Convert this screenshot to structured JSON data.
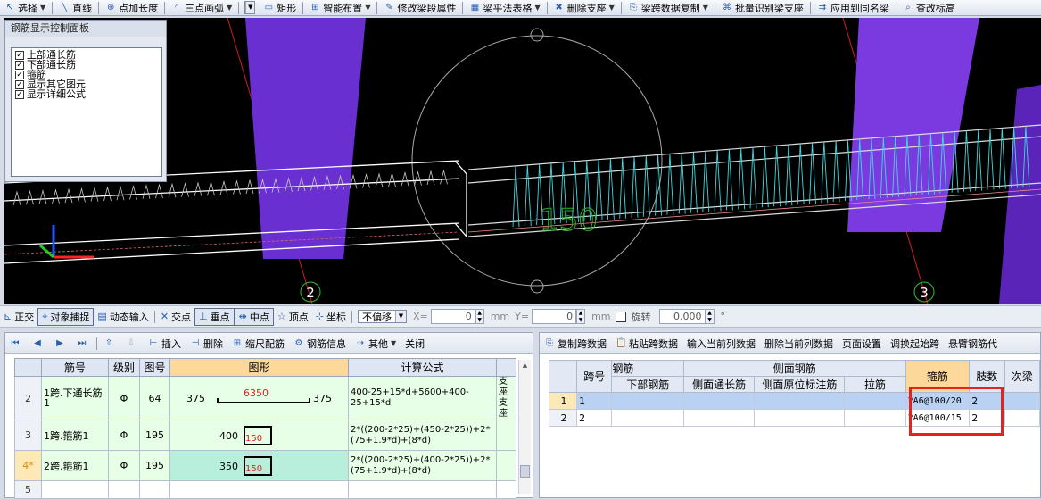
{
  "toolbar": {
    "items": [
      {
        "label": "选择",
        "icon": "cursor-icon",
        "dropdown": true
      },
      {
        "label": "直线",
        "icon": "line-icon",
        "dropdown": false
      },
      {
        "label": "点加长度",
        "icon": "point-length-icon",
        "dropdown": false
      },
      {
        "label": "三点画弧",
        "icon": "arc-icon",
        "dropdown": true
      },
      {
        "label": "矩形",
        "icon": "rectangle-icon",
        "dropdown": false
      },
      {
        "label": "智能布置",
        "icon": "smart-layout-icon",
        "dropdown": true
      },
      {
        "label": "修改梁段属性",
        "icon": "edit-beam-icon",
        "dropdown": false
      },
      {
        "label": "梁平法表格",
        "icon": "table-icon",
        "dropdown": true
      },
      {
        "label": "删除支座",
        "icon": "delete-support-icon",
        "dropdown": true
      },
      {
        "label": "梁跨数据复制",
        "icon": "copy-span-icon",
        "dropdown": true
      },
      {
        "label": "批量识别梁支座",
        "icon": "batch-identify-icon",
        "dropdown": false
      },
      {
        "label": "应用到同名梁",
        "icon": "apply-same-icon",
        "dropdown": false
      },
      {
        "label": "查改标高",
        "icon": "elevation-icon",
        "dropdown": false
      }
    ]
  },
  "panel": {
    "title": "钢筋显示控制面板",
    "options": [
      {
        "label": "上部通长筋",
        "checked": true
      },
      {
        "label": "下部通长筋",
        "checked": true
      },
      {
        "label": "箍筋",
        "checked": true
      },
      {
        "label": "显示其它图元",
        "checked": true
      },
      {
        "label": "显示详细公式",
        "checked": true
      }
    ]
  },
  "viewport": {
    "axis_labels": [
      "2",
      "3"
    ],
    "dimension_text": "150",
    "colors": {
      "beam": "#ffffff",
      "stirrup": "#40d8e0",
      "column": "#6a2fd0",
      "axis": "#cc2020",
      "grid_label": "#30c030"
    }
  },
  "snapbar": {
    "ortho": "正交",
    "object_snap": "对象捕捉",
    "dynamic_input": "动态输入",
    "intersection": "交点",
    "perpendicular": "垂点",
    "midpoint": "中点",
    "vertex": "顶点",
    "coordinate": "坐标",
    "offset_mode": "不偏移",
    "x_label": "X=",
    "x_value": "0",
    "unit": "mm",
    "y_label": "Y=",
    "y_value": "0",
    "rotate_label": "旋转",
    "rotate_value": "0.000",
    "degree": "°"
  },
  "left_toolbar": {
    "items": [
      "插入",
      "删除",
      "缩尺配筋",
      "钢筋信息",
      "其他",
      "关闭"
    ]
  },
  "rebar_table": {
    "headers": [
      "筋号",
      "级别",
      "图号",
      "图形",
      "计算公式",
      "支座"
    ],
    "rows": [
      {
        "num": "2",
        "name": "1跨.下通长筋1",
        "grade": "Φ",
        "fig": "64",
        "shape_left": "375",
        "shape_mid": "6350",
        "shape_right": "375",
        "formula": "400-25+15*d+5600+400-25+15*d",
        "extra": "支座支座"
      },
      {
        "num": "3",
        "name": "1跨.箍筋1",
        "grade": "Φ",
        "fig": "195",
        "shape_left": "400",
        "shape_mid": "150",
        "shape_right": "",
        "formula": "2*((200-2*25)+(450-2*25))+2*(75+1.9*d)+(8*d)",
        "extra": ""
      },
      {
        "num": "4*",
        "name": "2跨.箍筋1",
        "grade": "Φ",
        "fig": "195",
        "shape_left": "350",
        "shape_mid": "150",
        "shape_right": "",
        "formula": "2*((200-2*25)+(400-2*25))+2*(75+1.9*d)+(8*d)",
        "extra": ""
      },
      {
        "num": "5",
        "name": "",
        "grade": "",
        "fig": "",
        "shape_left": "",
        "shape_mid": "",
        "shape_right": "",
        "formula": "",
        "extra": ""
      }
    ]
  },
  "right_toolbar": {
    "items": [
      "复制跨数据",
      "粘贴跨数据",
      "输入当前列数据",
      "删除当前列数据",
      "页面设置",
      "调换起始跨",
      "悬臂钢筋代"
    ]
  },
  "span_table": {
    "group_headers": [
      "跨号",
      "钢筋",
      "侧面钢筋",
      "箍筋",
      "肢数",
      "次梁"
    ],
    "sub_headers": [
      "下部钢筋",
      "侧面通长筋",
      "侧面原位标注筋",
      "拉筋"
    ],
    "rows": [
      {
        "row": "1",
        "span": "1",
        "stirrup": "2A6@100/20",
        "legs": "2"
      },
      {
        "row": "2",
        "span": "2",
        "stirrup": "2A6@100/15",
        "legs": "2"
      }
    ]
  }
}
